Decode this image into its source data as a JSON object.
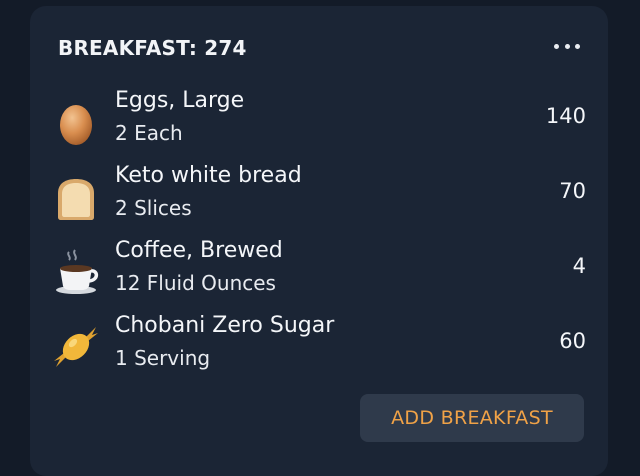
{
  "meal": {
    "title": "BREAKFAST: 274",
    "more_icon": "more-horizontal-icon"
  },
  "items": [
    {
      "name": "Eggs, Large",
      "quantity": "2 Each",
      "calories": "140",
      "icon": "egg-icon"
    },
    {
      "name": "Keto white bread",
      "quantity": "2 Slices",
      "calories": "70",
      "icon": "bread-icon"
    },
    {
      "name": "Coffee, Brewed",
      "quantity": "12 Fluid Ounces",
      "calories": "4",
      "icon": "coffee-icon"
    },
    {
      "name": "Chobani Zero Sugar",
      "quantity": "1 Serving",
      "calories": "60",
      "icon": "candy-icon"
    }
  ],
  "actions": {
    "add_label": "ADD BREAKFAST"
  },
  "colors": {
    "background": "#131b28",
    "card": "#1b2535",
    "button": "#2f3a4b",
    "accent": "#f0a247"
  }
}
